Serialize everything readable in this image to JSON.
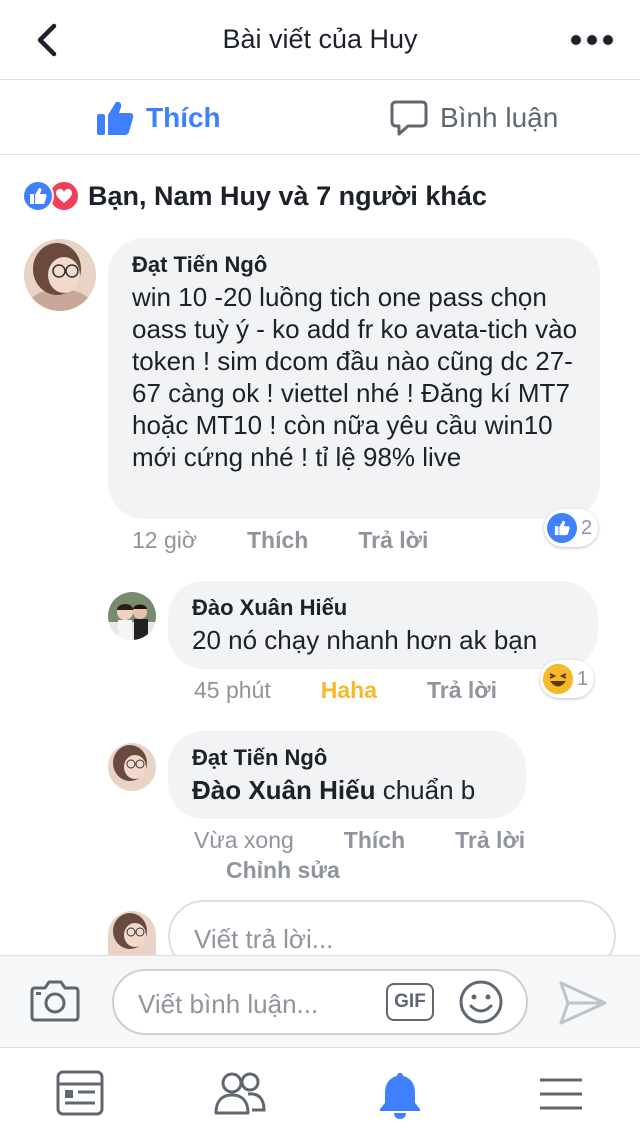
{
  "header": {
    "title": "Bài viết của Huy"
  },
  "actions": {
    "like_label": "Thích",
    "comment_label": "Bình luận"
  },
  "reactions": {
    "summary": "Bạn, Nam Huy và 7 người khác"
  },
  "comments": [
    {
      "author": "Đạt Tiến Ngô",
      "text": "win 10 -20 luồng  tich one pass chọn oass tuỳ ý - ko add fr ko avata-tich vào token ! sim dcom đầu nào cũng dc 27-67 càng ok ! viettel nhé ! Đăng kí MT7 hoặc MT10 ! còn nữa yêu cầu win10 mới cứng nhé ! tỉ lệ 98% live",
      "time": "12 giờ",
      "like_label": "Thích",
      "reply_label": "Trả lời",
      "reaction_count": "2"
    },
    {
      "author": "Đào Xuân Hiếu",
      "text": "20 nó chạy nhanh hơn ak bạn",
      "time": "45 phút",
      "like_label": "Haha",
      "reply_label": "Trả lời",
      "reaction_count": "1"
    },
    {
      "author": "Đạt Tiến Ngô",
      "mention": "Đào Xuân Hiếu",
      "text": " chuẩn b",
      "time": "Vừa xong",
      "like_label": "Thích",
      "reply_label": "Trả lời",
      "edit_label": "Chỉnh sửa"
    }
  ],
  "reply_input": {
    "placeholder": "Viết trả lời..."
  },
  "composer": {
    "placeholder": "Viết bình luận...",
    "gif_label": "GIF"
  },
  "colors": {
    "accent": "#4080ff",
    "love": "#f33e58",
    "haha": "#f7b928",
    "bubble": "#f2f3f5"
  },
  "icons": [
    "chevron-left-icon",
    "more-icon",
    "thumbs-up-icon",
    "comment-icon",
    "camera-icon",
    "gif-icon",
    "smile-icon",
    "send-icon",
    "news-feed-icon",
    "friends-icon",
    "bell-icon",
    "menu-icon"
  ]
}
